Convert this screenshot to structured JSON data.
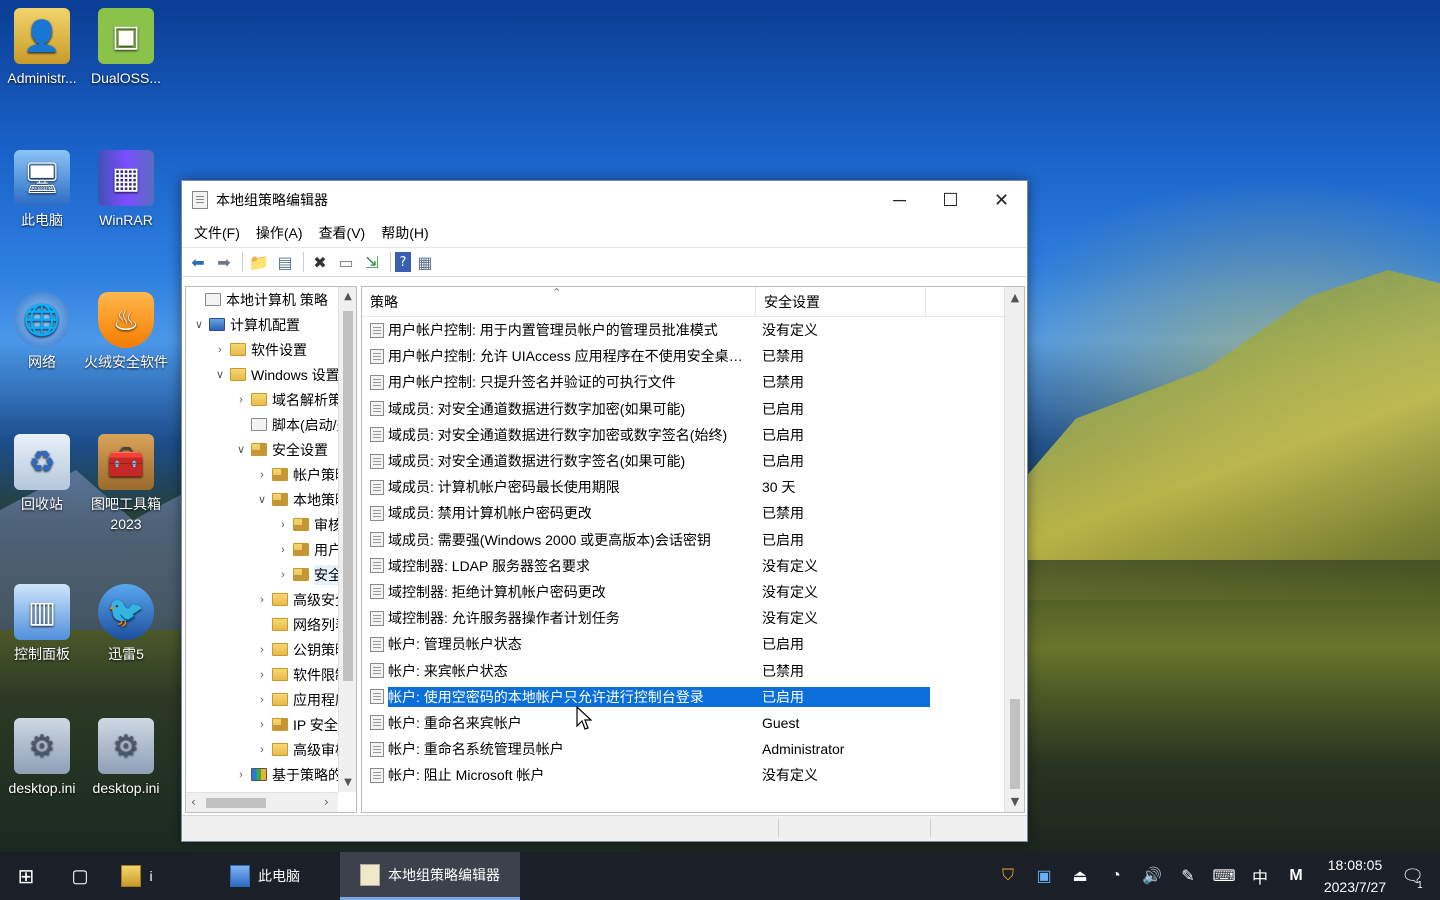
{
  "desktop": {
    "icons": [
      {
        "label": "Administr...",
        "icon": "user-folder-icon"
      },
      {
        "label": "DualOSS...",
        "icon": "android-icon"
      },
      {
        "label": "此电脑",
        "icon": "computer-icon"
      },
      {
        "label": "WinRAR",
        "icon": "winrar-icon"
      },
      {
        "label": "网络",
        "icon": "network-icon"
      },
      {
        "label": "火绒安全软件",
        "icon": "huorong-shield-icon"
      },
      {
        "label": "回收站",
        "icon": "recycle-bin-icon"
      },
      {
        "label": "图吧工具箱2023",
        "icon": "toolbox-icon"
      },
      {
        "label": "控制面板",
        "icon": "control-panel-icon"
      },
      {
        "label": "迅雷5",
        "icon": "xunlei-icon"
      },
      {
        "label": "desktop.ini",
        "icon": "ini-file-icon"
      },
      {
        "label": "desktop.ini",
        "icon": "ini-file-icon"
      }
    ]
  },
  "window": {
    "title": "本地组策略编辑器",
    "menu": [
      "文件(F)",
      "操作(A)",
      "查看(V)",
      "帮助(H)"
    ],
    "tree": [
      {
        "label": "本地计算机 策略",
        "expander": "",
        "icon": "doc"
      },
      {
        "label": "计算机配置",
        "expander": "∨",
        "icon": "pc"
      },
      {
        "label": "软件设置",
        "expander": "›",
        "icon": "folder"
      },
      {
        "label": "Windows 设置",
        "expander": "∨",
        "icon": "folder"
      },
      {
        "label": "域名解析策略",
        "expander": "›",
        "icon": "folder"
      },
      {
        "label": "脚本(启动/关机)",
        "expander": "",
        "icon": "doc"
      },
      {
        "label": "安全设置",
        "expander": "∨",
        "icon": "sec"
      },
      {
        "label": "帐户策略",
        "expander": "›",
        "icon": "sec"
      },
      {
        "label": "本地策略",
        "expander": "∨",
        "icon": "sec"
      },
      {
        "label": "审核策略",
        "expander": "›",
        "icon": "sec"
      },
      {
        "label": "用户权限分配",
        "expander": "›",
        "icon": "sec"
      },
      {
        "label": "安全选项",
        "expander": "›",
        "icon": "sec"
      },
      {
        "label": "高级安全 Windows",
        "expander": "›",
        "icon": "folder"
      },
      {
        "label": "网络列表管理器",
        "expander": "",
        "icon": "folder"
      },
      {
        "label": "公钥策略",
        "expander": "›",
        "icon": "folder"
      },
      {
        "label": "软件限制策略",
        "expander": "›",
        "icon": "folder"
      },
      {
        "label": "应用程序控制策略",
        "expander": "›",
        "icon": "folder"
      },
      {
        "label": "IP 安全策略",
        "expander": "›",
        "icon": "sec"
      },
      {
        "label": "高级审核策略配置",
        "expander": "›",
        "icon": "folder"
      },
      {
        "label": "基于策略的 QoS",
        "expander": "›",
        "icon": "chart"
      }
    ],
    "list": {
      "columns": [
        "策略",
        "安全设置"
      ],
      "rows": [
        {
          "policy": "用户帐户控制: 用于内置管理员帐户的管理员批准模式",
          "setting": "没有定义"
        },
        {
          "policy": "用户帐户控制: 允许 UIAccess 应用程序在不使用安全桌面...",
          "setting": "已禁用"
        },
        {
          "policy": "用户帐户控制: 只提升签名并验证的可执行文件",
          "setting": "已禁用"
        },
        {
          "policy": "域成员: 对安全通道数据进行数字加密(如果可能)",
          "setting": "已启用"
        },
        {
          "policy": "域成员: 对安全通道数据进行数字加密或数字签名(始终)",
          "setting": "已启用"
        },
        {
          "policy": "域成员: 对安全通道数据进行数字签名(如果可能)",
          "setting": "已启用"
        },
        {
          "policy": "域成员: 计算机帐户密码最长使用期限",
          "setting": "30 天"
        },
        {
          "policy": "域成员: 禁用计算机帐户密码更改",
          "setting": "已禁用"
        },
        {
          "policy": "域成员: 需要强(Windows 2000 或更高版本)会话密钥",
          "setting": "已启用"
        },
        {
          "policy": "域控制器: LDAP 服务器签名要求",
          "setting": "没有定义"
        },
        {
          "policy": "域控制器: 拒绝计算机帐户密码更改",
          "setting": "没有定义"
        },
        {
          "policy": "域控制器: 允许服务器操作者计划任务",
          "setting": "没有定义"
        },
        {
          "policy": "帐户: 管理员帐户状态",
          "setting": "已启用"
        },
        {
          "policy": "帐户: 来宾帐户状态",
          "setting": "已禁用"
        },
        {
          "policy": "帐户: 使用空密码的本地帐户只允许进行控制台登录",
          "setting": "已启用"
        },
        {
          "policy": "帐户: 重命名来宾帐户",
          "setting": "Guest"
        },
        {
          "policy": "帐户: 重命名系统管理员帐户",
          "setting": "Administrator"
        },
        {
          "policy": "帐户: 阻止 Microsoft 帐户",
          "setting": "没有定义"
        }
      ],
      "selected_index": 14
    }
  },
  "taskbar": {
    "apps": [
      {
        "label": "i",
        "icon": "user-folder-icon"
      },
      {
        "label": "此电脑",
        "icon": "computer-icon"
      },
      {
        "label": "本地组策略编辑器",
        "icon": "policy-editor-icon"
      }
    ],
    "tray": {
      "ime_lang": "中",
      "ime_mode": "M",
      "time": "18:08:05",
      "date": "2023/7/27",
      "notification_count": "1"
    }
  },
  "colors": {
    "selection": "#0a6fd8",
    "taskbar": "#1b1f27"
  }
}
